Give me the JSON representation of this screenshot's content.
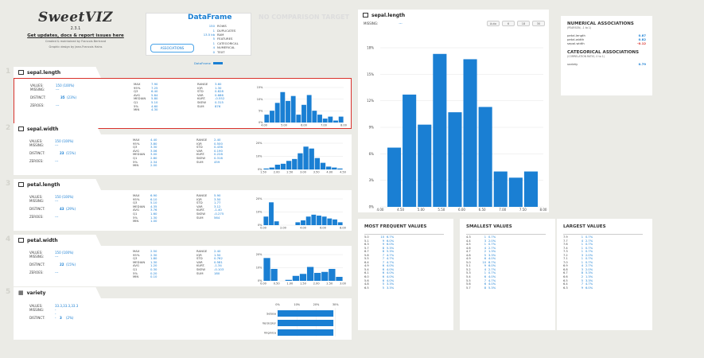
{
  "logo": {
    "brand": "SweetVIZ",
    "version": "2.3.1",
    "update_link": "Get updates, docs & report issues here",
    "credit_line1": "Created & maintained by Francois Bertrand",
    "credit_line2": "Graphic design by Jean-Francois Hains"
  },
  "dataframe": {
    "title": "DataFrame",
    "no_comparison": "NO COMPARISON TARGET",
    "stats": [
      {
        "n": "150",
        "label": "ROWS"
      },
      {
        "n": "1",
        "label": "DUPLICATES"
      },
      {
        "n": "13.5 kb",
        "label": "RAM"
      },
      {
        "n": "5",
        "label": "FEATURES"
      },
      {
        "n": "1",
        "label": "CATEGORICAL"
      },
      {
        "n": "4",
        "label": "NUMERICAL"
      },
      {
        "n": "0",
        "label": "TEXT"
      }
    ],
    "associations_button": "ASSOCIATIONS",
    "legend_label": "DataFrame"
  },
  "features": [
    {
      "num": "1",
      "name": "sepal.length",
      "values": "150 (100%)",
      "missing": "---",
      "distinct": "35",
      "distinct_pct": "(23%)",
      "zeroes": "---",
      "stats1": [
        [
          "MAX",
          "7.90"
        ],
        [
          "95%",
          "7.25"
        ],
        [
          "Q3",
          "6.40"
        ],
        [
          "AVG",
          "5.84"
        ],
        [
          "MEDIAN",
          "5.80"
        ],
        [
          "Q1",
          "5.10"
        ],
        [
          "5%",
          "4.60"
        ],
        [
          "MIN",
          "4.30"
        ]
      ],
      "stats2": [
        [
          "RANGE",
          "3.60"
        ],
        [
          "IQR",
          "1.30"
        ],
        [
          "STD",
          "0.828"
        ],
        [
          "VAR",
          "0.686"
        ],
        [
          "",
          ""
        ],
        [
          "KURT.",
          "-0.552"
        ],
        [
          "SKEW",
          "0.315"
        ],
        [
          "SUM",
          "876"
        ]
      ],
      "yticks": [
        "15%",
        "10%",
        "5%",
        "0%"
      ],
      "xticks": [
        "4.00",
        "5.00",
        "6.00",
        "7.00",
        "8.00"
      ],
      "bars": [
        4.0,
        6.0,
        10.0,
        15.5,
        11.0,
        13.5,
        4.0,
        9.0,
        14.0,
        6.0,
        4.0,
        2.0,
        3.0,
        1.0,
        3.0
      ]
    },
    {
      "num": "2",
      "name": "sepal.width",
      "values": "150 (100%)",
      "missing": "---",
      "distinct": "23",
      "distinct_pct": "(15%)",
      "zeroes": "---",
      "stats1": [
        [
          "MAX",
          "4.40"
        ],
        [
          "95%",
          "3.80"
        ],
        [
          "Q3",
          "3.30"
        ],
        [
          "AVG",
          "3.06"
        ],
        [
          "MEDIAN",
          "3.00"
        ],
        [
          "Q1",
          "2.80"
        ],
        [
          "5%",
          "2.34"
        ],
        [
          "MIN",
          "2.00"
        ]
      ],
      "stats2": [
        [
          "RANGE",
          "2.40"
        ],
        [
          "IQR",
          "0.500"
        ],
        [
          "STD",
          "0.436"
        ],
        [
          "VAR",
          "0.190"
        ],
        [
          "",
          ""
        ],
        [
          "KURT.",
          "0.228"
        ],
        [
          "SKEW",
          "0.316"
        ],
        [
          "SUM",
          "459"
        ]
      ],
      "yticks": [
        "20%",
        "10%",
        "0%"
      ],
      "xticks": [
        "1.50",
        "2.00",
        "2.50",
        "3.00",
        "3.50",
        "4.00",
        "4.50"
      ],
      "bars": [
        1.0,
        2.0,
        5.0,
        6.0,
        9.0,
        11.0,
        17.0,
        24.0,
        22.0,
        12.0,
        7.0,
        3.0,
        2.0,
        1.0
      ]
    },
    {
      "num": "3",
      "name": "petal.length",
      "values": "150 (100%)",
      "missing": "---",
      "distinct": "43",
      "distinct_pct": "(29%)",
      "zeroes": "---",
      "stats1": [
        [
          "MAX",
          "6.90"
        ],
        [
          "95%",
          "6.10"
        ],
        [
          "Q3",
          "5.10"
        ],
        [
          "MEDIAN",
          "4.35"
        ],
        [
          "AVG",
          "3.76"
        ],
        [
          "Q1",
          "1.60"
        ],
        [
          "5%",
          "1.30"
        ],
        [
          "MIN",
          "1.00"
        ]
      ],
      "stats2": [
        [
          "RANGE",
          "5.90"
        ],
        [
          "IQR",
          "3.50"
        ],
        [
          "STD",
          "1.77"
        ],
        [
          "VAR",
          "3.12"
        ],
        [
          "",
          ""
        ],
        [
          "KURT.",
          "-1.40"
        ],
        [
          "SKEW",
          "-0.275"
        ],
        [
          "SUM",
          "564"
        ]
      ],
      "yticks": [
        "20%",
        "10%",
        "0%"
      ],
      "xticks": [
        "0.00",
        "2.00",
        "4.00",
        "6.00",
        "8.00"
      ],
      "bars": [
        9.0,
        24.0,
        4.0,
        0.0,
        0.0,
        0.0,
        3.0,
        5.0,
        9.0,
        11.0,
        10.0,
        9.0,
        7.0,
        6.0,
        3.0
      ]
    },
    {
      "num": "4",
      "name": "petal.width",
      "values": "150 (100%)",
      "missing": "---",
      "distinct": "22",
      "distinct_pct": "(15%)",
      "zeroes": "---",
      "stats1": [
        [
          "MAX",
          "2.50"
        ],
        [
          "95%",
          "2.30"
        ],
        [
          "Q3",
          "1.80"
        ],
        [
          "MEDIAN",
          "1.30"
        ],
        [
          "AVG",
          "1.20"
        ],
        [
          "Q1",
          "0.30"
        ],
        [
          "5%",
          "0.20"
        ],
        [
          "MIN",
          "0.10"
        ]
      ],
      "stats2": [
        [
          "RANGE",
          "2.40"
        ],
        [
          "IQR",
          "1.50"
        ],
        [
          "STD",
          "0.762"
        ],
        [
          "VAR",
          "0.581"
        ],
        [
          "",
          ""
        ],
        [
          "KURT.",
          "-1.34"
        ],
        [
          "SKEW",
          "-0.103"
        ],
        [
          "SUM",
          "180"
        ]
      ],
      "yticks": [
        "20%",
        "10%",
        "0%"
      ],
      "xticks": [
        "0.00",
        "0.50",
        "1.00",
        "1.50",
        "2.00",
        "2.50",
        "3.00"
      ],
      "bars": [
        23.0,
        12.0,
        0.0,
        1.0,
        5.0,
        7.0,
        14.0,
        8.0,
        9.0,
        12.0,
        4.0
      ]
    }
  ],
  "variety": {
    "num": "5",
    "name": "variety",
    "values": [
      33.3,
      33.3,
      33.3
    ],
    "missing": "---",
    "distinct": "3",
    "distinct_pct": "(2%)",
    "xticks": [
      "0%",
      "10%",
      "20%",
      "30%"
    ],
    "categories": [
      "Setosa",
      "Versicolor",
      "Virginica"
    ]
  },
  "detail": {
    "name": "sepal.length",
    "missing_label": "MISSING:",
    "missing_value": "---",
    "bin_buttons": [
      "Auto",
      "6",
      "18",
      "30"
    ],
    "yticks": [
      "18%",
      "15%",
      "12%",
      "9%",
      "6%",
      "3%",
      "0%"
    ],
    "xticks": [
      "4.00",
      "4.50",
      "5.00",
      "5.50",
      "6.00",
      "6.50",
      "7.00",
      "7.50",
      "8.00"
    ],
    "bars": [
      6.7,
      12.7,
      9.3,
      17.3,
      10.7,
      16.7,
      11.3,
      4.0,
      3.3,
      4.0
    ]
  },
  "associations": {
    "numerical_title": "NUMERICAL ASSOCIATIONS",
    "numerical_sub": "(PEARSON, -1 to 1)",
    "numerical": [
      [
        "petal.length",
        "0.87",
        "#1a7fd3"
      ],
      [
        "petal.width",
        "0.82",
        "#1a7fd3"
      ],
      [
        "sepal.width",
        "-0.12",
        "#d9322c"
      ]
    ],
    "categorical_title": "CATEGORICAL ASSOCIATIONS",
    "categorical_sub": "(CORRELATION RATIO, 0 to 1)",
    "categorical": [
      [
        "variety",
        "0.79",
        "#1a7fd3"
      ]
    ]
  },
  "most_frequent": {
    "title": "MOST FREQUENT VALUES",
    "rows": [
      [
        "5.0",
        "10",
        "6.7%"
      ],
      [
        "5.1",
        "9",
        "6.0%"
      ],
      [
        "6.3",
        "9",
        "6.0%"
      ],
      [
        "5.7",
        "8",
        "5.3%"
      ],
      [
        "6.7",
        "8",
        "5.3%"
      ],
      [
        "5.8",
        "7",
        "4.7%"
      ],
      [
        "5.5",
        "7",
        "4.7%"
      ],
      [
        "6.4",
        "7",
        "4.7%"
      ],
      [
        "4.9",
        "6",
        "4.0%"
      ],
      [
        "5.4",
        "6",
        "4.0%"
      ],
      [
        "6.1",
        "6",
        "4.0%"
      ],
      [
        "6.0",
        "6",
        "4.0%"
      ],
      [
        "5.6",
        "6",
        "4.0%"
      ],
      [
        "4.8",
        "5",
        "3.3%"
      ],
      [
        "6.5",
        "5",
        "3.3%"
      ]
    ]
  },
  "smallest": {
    "title": "SMALLEST VALUES",
    "rows": [
      [
        "4.3",
        "1",
        "0.7%"
      ],
      [
        "4.4",
        "3",
        "2.0%"
      ],
      [
        "4.5",
        "1",
        "0.7%"
      ],
      [
        "4.6",
        "4",
        "2.7%"
      ],
      [
        "4.7",
        "2",
        "1.3%"
      ],
      [
        "4.8",
        "5",
        "3.3%"
      ],
      [
        "4.9",
        "6",
        "4.0%"
      ],
      [
        "5.0",
        "10",
        "6.7%"
      ],
      [
        "5.1",
        "9",
        "6.0%"
      ],
      [
        "5.2",
        "4",
        "2.7%"
      ],
      [
        "5.3",
        "1",
        "0.7%"
      ],
      [
        "5.4",
        "6",
        "4.0%"
      ],
      [
        "5.5",
        "7",
        "4.7%"
      ],
      [
        "5.6",
        "6",
        "4.0%"
      ],
      [
        "5.7",
        "8",
        "5.3%"
      ]
    ]
  },
  "largest": {
    "title": "LARGEST VALUES",
    "rows": [
      [
        "7.9",
        "1",
        "0.7%"
      ],
      [
        "7.7",
        "4",
        "2.7%"
      ],
      [
        "7.6",
        "1",
        "0.7%"
      ],
      [
        "7.4",
        "1",
        "0.7%"
      ],
      [
        "7.3",
        "1",
        "0.7%"
      ],
      [
        "7.2",
        "3",
        "2.0%"
      ],
      [
        "7.1",
        "1",
        "0.7%"
      ],
      [
        "7.0",
        "1",
        "0.7%"
      ],
      [
        "6.9",
        "4",
        "2.7%"
      ],
      [
        "6.8",
        "3",
        "2.0%"
      ],
      [
        "6.7",
        "8",
        "5.3%"
      ],
      [
        "6.6",
        "2",
        "1.3%"
      ],
      [
        "6.5",
        "5",
        "3.3%"
      ],
      [
        "6.4",
        "7",
        "4.7%"
      ],
      [
        "6.3",
        "9",
        "6.0%"
      ]
    ]
  },
  "labels": {
    "values": "VALUES:",
    "missing": "MISSING:",
    "distinct": "DISTINCT:",
    "zeroes": "ZEROES:"
  },
  "colors": {
    "accent": "#1a7fd3",
    "selected_border": "#d9322c",
    "bar": "#1a7fd3"
  }
}
